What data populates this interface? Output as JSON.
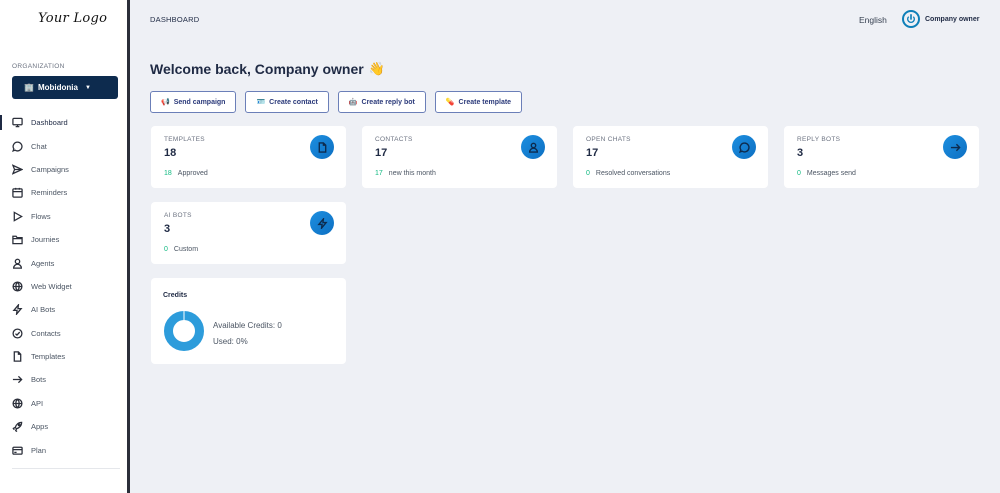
{
  "sidebar": {
    "logo": "Your Logo",
    "org_label": "ORGANIZATION",
    "org_name": "Mobidonia",
    "items": [
      {
        "label": "Dashboard",
        "icon": "monitor-icon"
      },
      {
        "label": "Chat",
        "icon": "chat-bubble-icon"
      },
      {
        "label": "Campaigns",
        "icon": "send-icon"
      },
      {
        "label": "Reminders",
        "icon": "calendar-icon"
      },
      {
        "label": "Flows",
        "icon": "play-icon"
      },
      {
        "label": "Journies",
        "icon": "folder-icon"
      },
      {
        "label": "Agents",
        "icon": "user-icon"
      },
      {
        "label": "Web Widget",
        "icon": "globe-icon"
      },
      {
        "label": "AI Bots",
        "icon": "bolt-icon"
      },
      {
        "label": "Contacts",
        "icon": "check-circle-icon"
      },
      {
        "label": "Templates",
        "icon": "file-icon"
      },
      {
        "label": "Bots",
        "icon": "arrow-right-icon"
      },
      {
        "label": "API",
        "icon": "globe-icon"
      },
      {
        "label": "Apps",
        "icon": "rocket-icon"
      },
      {
        "label": "Plan",
        "icon": "credit-card-icon"
      }
    ]
  },
  "header": {
    "breadcrumb": "DASHBOARD",
    "language": "English",
    "user_name": "Company owner"
  },
  "welcome": {
    "text": "Welcome back, Company owner",
    "emoji": "👋"
  },
  "actions": [
    {
      "label": "Send campaign",
      "icon": "📢"
    },
    {
      "label": "Create contact",
      "icon": "🪪"
    },
    {
      "label": "Create reply bot",
      "icon": "🤖"
    },
    {
      "label": "Create template",
      "icon": "💊"
    }
  ],
  "stats": [
    {
      "label": "TEMPLATES",
      "value": "18",
      "sub_num": "18",
      "sub_text": "Approved",
      "icon": "file-icon"
    },
    {
      "label": "CONTACTS",
      "value": "17",
      "sub_num": "17",
      "sub_text": "new this month",
      "icon": "user-icon"
    },
    {
      "label": "OPEN CHATS",
      "value": "17",
      "sub_num": "0",
      "sub_text": "Resolved conversations",
      "icon": "chat-bubble-icon"
    },
    {
      "label": "REPLY BOTS",
      "value": "3",
      "sub_num": "0",
      "sub_text": "Messages send",
      "icon": "arrow-right-icon"
    },
    {
      "label": "AI BOTS",
      "value": "3",
      "sub_num": "0",
      "sub_text": "Custom",
      "icon": "bolt-icon"
    }
  ],
  "credits": {
    "title": "Credits",
    "available": "Available Credits: 0",
    "used": "Used: 0%",
    "used_fraction": 0.0,
    "ring_color": "#2d9cdb"
  }
}
